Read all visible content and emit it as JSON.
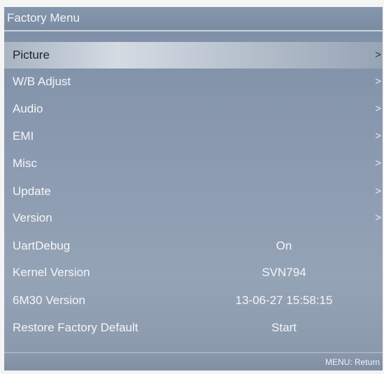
{
  "title": "Factory Menu",
  "items": [
    {
      "label": "Picture",
      "arrow": ">",
      "selected": true
    },
    {
      "label": "W/B Adjust",
      "arrow": ">"
    },
    {
      "label": "Audio",
      "arrow": ">"
    },
    {
      "label": "EMI",
      "arrow": ">"
    },
    {
      "label": "Misc",
      "arrow": ">"
    },
    {
      "label": "Update",
      "arrow": ">"
    },
    {
      "label": "Version",
      "arrow": ">"
    },
    {
      "label": "UartDebug",
      "value": "On"
    },
    {
      "label": "Kernel Version",
      "value": "SVN794"
    },
    {
      "label": "6M30 Version",
      "value": "13-06-27 15:58:15"
    },
    {
      "label": "Restore Factory Default",
      "value": "Start"
    }
  ],
  "footer": {
    "hint": "MENU: Return"
  }
}
